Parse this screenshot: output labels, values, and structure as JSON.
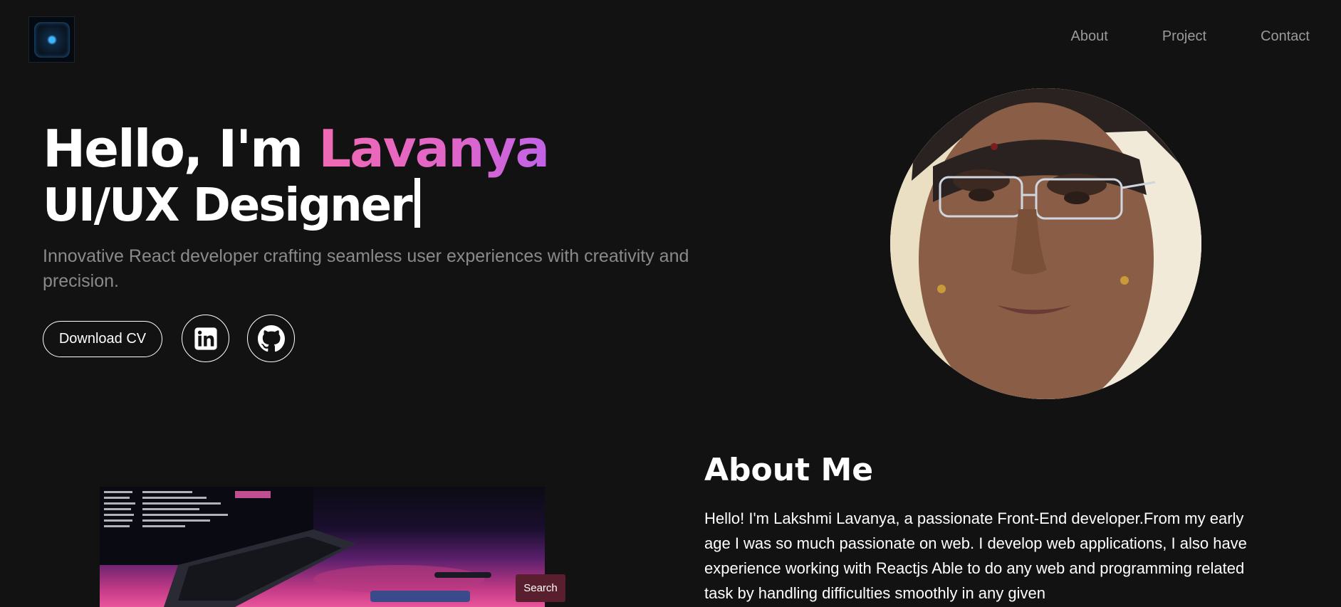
{
  "nav": {
    "links": [
      "About",
      "Project",
      "Contact"
    ]
  },
  "hero": {
    "greeting": "Hello, I'm ",
    "name": "Lavanya",
    "role": "UI/UX Designer",
    "subtitle": "Innovative React developer crafting seamless user experiences with creativity and precision.",
    "download_cv": "Download CV"
  },
  "about": {
    "title": "About Me",
    "text": "Hello! I'm Lakshmi Lavanya, a passionate Front-End developer.From my early age I was so much passionate on web. I develop web applications, I also have experience working with Reactjs Able to do any web and programming related task by handling difficulties smoothly in any given"
  },
  "search_button": "Search",
  "colors": {
    "background": "#121212",
    "name_gradient_start": "#f06ab3",
    "name_gradient_end": "#c163e6",
    "muted_text": "#8a8a8a"
  },
  "icons": [
    "logo-icon",
    "linkedin-icon",
    "github-icon"
  ]
}
